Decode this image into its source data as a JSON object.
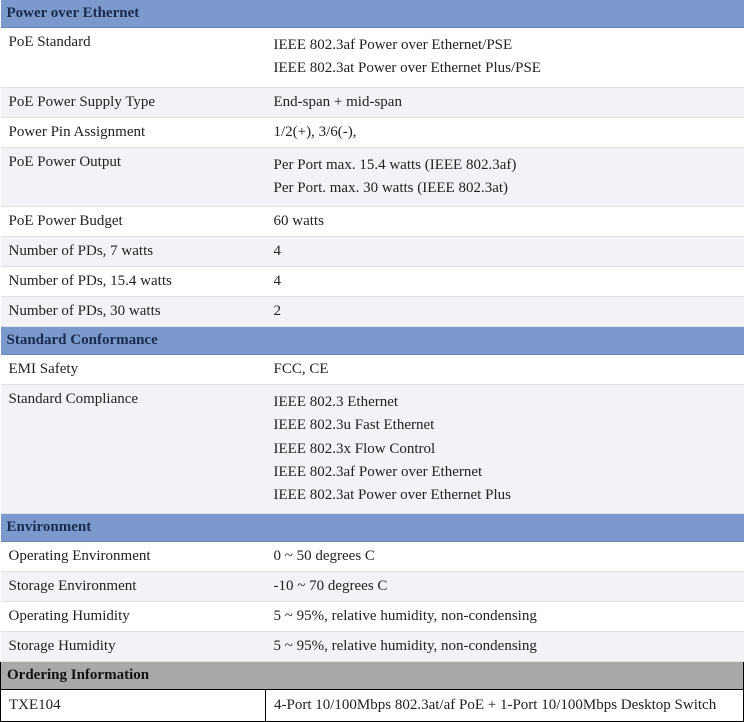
{
  "sections": {
    "poe": {
      "header": "Power over Ethernet",
      "rows": {
        "standard_label": "PoE Standard",
        "standard_val1": "IEEE 802.3af Power over Ethernet/PSE",
        "standard_val2": "IEEE 802.3at Power over Ethernet Plus/PSE",
        "supply_type_label": "PoE Power Supply Type",
        "supply_type_val": "End-span + mid-span",
        "pin_label": "Power Pin Assignment",
        "pin_val": "1/2(+), 3/6(-),",
        "output_label": "PoE Power Output",
        "output_val1": "Per Port max. 15.4 watts (IEEE 802.3af)",
        "output_val2": "Per Port. max. 30 watts (IEEE 802.3at)",
        "budget_label": "PoE Power Budget",
        "budget_val": "60 watts",
        "pd7_label": "Number of PDs, 7 watts",
        "pd7_val": "4",
        "pd15_label": "Number of PDs, 15.4 watts",
        "pd15_val": "4",
        "pd30_label": "Number of PDs, 30 watts",
        "pd30_val": "2"
      }
    },
    "conformance": {
      "header": "Standard Conformance",
      "rows": {
        "emi_label": "EMI Safety",
        "emi_val": "FCC, CE",
        "compliance_label": "Standard Compliance",
        "compliance_val1": "IEEE 802.3 Ethernet",
        "compliance_val2": "IEEE 802.3u Fast Ethernet",
        "compliance_val3": "IEEE 802.3x Flow Control",
        "compliance_val4": "IEEE 802.3af Power over Ethernet",
        "compliance_val5": "IEEE 802.3at Power over Ethernet Plus"
      }
    },
    "environment": {
      "header": "Environment",
      "rows": {
        "op_env_label": "Operating Environment",
        "op_env_val": "0 ~ 50 degrees C",
        "storage_env_label": "Storage Environment",
        "storage_env_val": "-10 ~ 70 degrees C",
        "op_hum_label": "Operating Humidity",
        "op_hum_val": "5 ~ 95%, relative humidity, non-condensing",
        "storage_hum_label": "Storage Humidity",
        "storage_hum_val": "5 ~ 95%, relative humidity, non-condensing"
      }
    },
    "ordering": {
      "header": "Ordering Information",
      "rows": {
        "model_label": "TXE104",
        "model_val": "4-Port 10/100Mbps 802.3at/af PoE + 1-Port 10/100Mbps Desktop Switch"
      }
    }
  }
}
